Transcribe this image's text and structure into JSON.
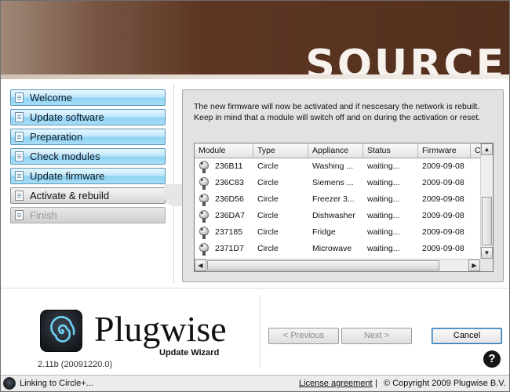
{
  "header": {
    "brand_text": "SOURCE"
  },
  "nav": {
    "items": [
      {
        "label": "Welcome",
        "state": "done"
      },
      {
        "label": "Update software",
        "state": "done"
      },
      {
        "label": "Preparation",
        "state": "done"
      },
      {
        "label": "Check modules",
        "state": "done"
      },
      {
        "label": "Update firmware",
        "state": "done"
      },
      {
        "label": "Activate & rebuild",
        "state": "active"
      },
      {
        "label": "Finish",
        "state": "disabled"
      }
    ]
  },
  "content": {
    "message_line1": "The new firmware will now be activated and if nescesary the network is rebuilt.",
    "message_line2": "Keep in mind that a module will switch off and on during the activation or reset.",
    "table": {
      "columns": [
        "Module",
        "Type",
        "Appliance",
        "Status",
        "Firmware",
        "C"
      ],
      "rows": [
        [
          "236B11",
          "Circle",
          "Washing ...",
          "waiting...",
          "2009-09-08"
        ],
        [
          "236C83",
          "Circle",
          "Siemens ...",
          "waiting...",
          "2009-09-08"
        ],
        [
          "236D56",
          "Circle",
          "Freezer 3...",
          "waiting...",
          "2009-09-08"
        ],
        [
          "236DA7",
          "Circle",
          "Dishwasher",
          "waiting...",
          "2009-09-08"
        ],
        [
          "237185",
          "Circle",
          "Fridge",
          "waiting...",
          "2009-09-08"
        ],
        [
          "2371D7",
          "Circle",
          "Microwave",
          "waiting...",
          "2009-09-08"
        ]
      ]
    }
  },
  "footer": {
    "logo_name": "Plugwise",
    "logo_sub": "Update Wizard",
    "version": "2.11b (20091220.0)",
    "previous_label": "< Previous",
    "next_label": "Next >",
    "cancel_label": "Cancel",
    "help_label": "?"
  },
  "status": {
    "text": "Linking to Circle+...",
    "license": "License agreement",
    "separator": "|",
    "copyright": "© Copyright 2009 Plugwise B.V."
  },
  "colors": {
    "nav_blue": "#8fd3f4",
    "header_brown": "#53301d",
    "cancel_border": "#2f6fa8"
  }
}
